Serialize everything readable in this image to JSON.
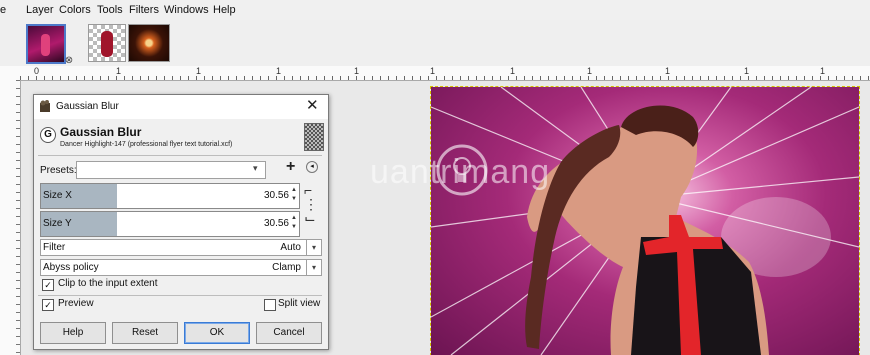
{
  "menubar": {
    "items": [
      "e",
      "Layer",
      "Colors",
      "Tools",
      "Filters",
      "Windows",
      "Help"
    ]
  },
  "tabs": {
    "close_glyph": "⊗"
  },
  "ruler": {
    "labels": [
      "0",
      "1",
      "1",
      "1",
      "1",
      "1",
      "1",
      "1",
      "1",
      "1",
      "1"
    ]
  },
  "watermark": {
    "text": "uantrimang"
  },
  "dialog": {
    "window_title": "Gaussian Blur",
    "close_glyph": "✕",
    "header_title": "Gaussian Blur",
    "header_subtitle": "Dancer Highlight-147 (professional flyer text tutorial.xcf)",
    "presets_label": "Presets:",
    "presets_value": "",
    "size_x": {
      "label": "Size X",
      "value": "30.56"
    },
    "size_y": {
      "label": "Size Y",
      "value": "30.56"
    },
    "filter": {
      "label": "Filter",
      "value": "Auto"
    },
    "abyss": {
      "label": "Abyss policy",
      "value": "Clamp"
    },
    "clip_label": "Clip to the input extent",
    "clip_checked": true,
    "preview_label": "Preview",
    "preview_checked": true,
    "split_label": "Split view",
    "split_checked": false,
    "buttons": {
      "help": "Help",
      "reset": "Reset",
      "ok": "OK",
      "cancel": "Cancel"
    }
  },
  "colors": {
    "canvas_bg": "#a42a78",
    "ok_focus": "#3a7bd5",
    "spin_fill": "#a9b6c1"
  }
}
